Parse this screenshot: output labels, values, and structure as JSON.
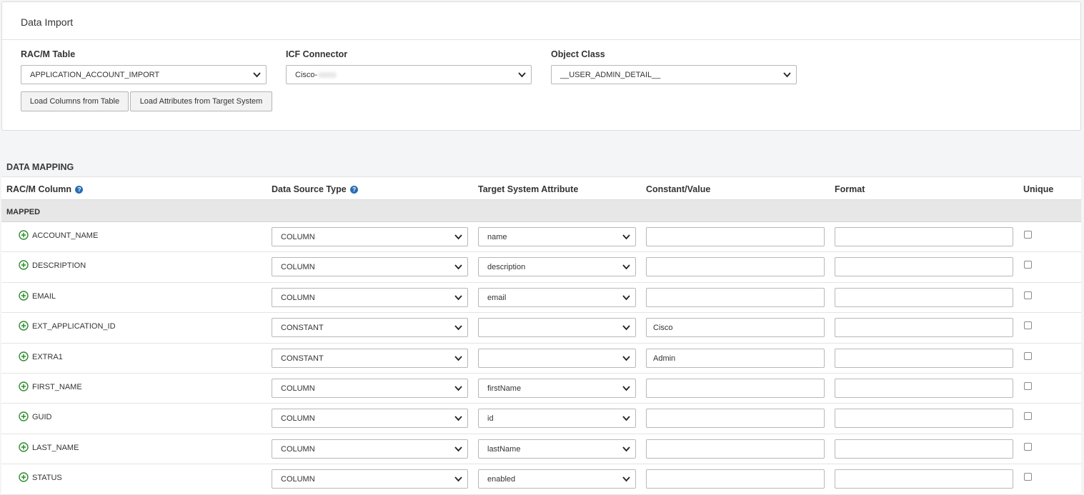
{
  "import_panel": {
    "title": "Data Import",
    "rac_table": {
      "label": "RAC/M Table",
      "value": "APPLICATION_ACCOUNT_IMPORT"
    },
    "icf_connector": {
      "label": "ICF Connector",
      "value": "Cisco-"
    },
    "object_class": {
      "label": "Object Class",
      "value": "__USER_ADMIN_DETAIL__"
    },
    "load_columns_label": "Load Columns from Table",
    "load_attributes_label": "Load Attributes from Target System"
  },
  "mapping": {
    "title": "DATA MAPPING",
    "headers": {
      "column": "RAC/M Column",
      "source_type": "Data Source Type",
      "target_attr": "Target System Attribute",
      "constant": "Constant/Value",
      "format": "Format",
      "unique": "Unique"
    },
    "group_label": "MAPPED",
    "rows": [
      {
        "column": "ACCOUNT_NAME",
        "source": "COLUMN",
        "target": "name",
        "constant": "",
        "format": ""
      },
      {
        "column": "DESCRIPTION",
        "source": "COLUMN",
        "target": "description",
        "constant": "",
        "format": ""
      },
      {
        "column": "EMAIL",
        "source": "COLUMN",
        "target": "email",
        "constant": "",
        "format": ""
      },
      {
        "column": "EXT_APPLICATION_ID",
        "source": "CONSTANT",
        "target": "",
        "constant": "Cisco",
        "format": ""
      },
      {
        "column": "EXTRA1",
        "source": "CONSTANT",
        "target": "",
        "constant": "Admin",
        "format": ""
      },
      {
        "column": "FIRST_NAME",
        "source": "COLUMN",
        "target": "firstName",
        "constant": "",
        "format": ""
      },
      {
        "column": "GUID",
        "source": "COLUMN",
        "target": "id",
        "constant": "",
        "format": ""
      },
      {
        "column": "LAST_NAME",
        "source": "COLUMN",
        "target": "lastName",
        "constant": "",
        "format": ""
      },
      {
        "column": "STATUS",
        "source": "COLUMN",
        "target": "enabled",
        "constant": "",
        "format": ""
      }
    ]
  },
  "icons": {
    "plus": "plus-circle-icon",
    "help": "help-icon",
    "chevron": "chevron-down-icon"
  },
  "colors": {
    "plus_green": "#2e8b2e",
    "help_blue": "#2a6db5"
  }
}
